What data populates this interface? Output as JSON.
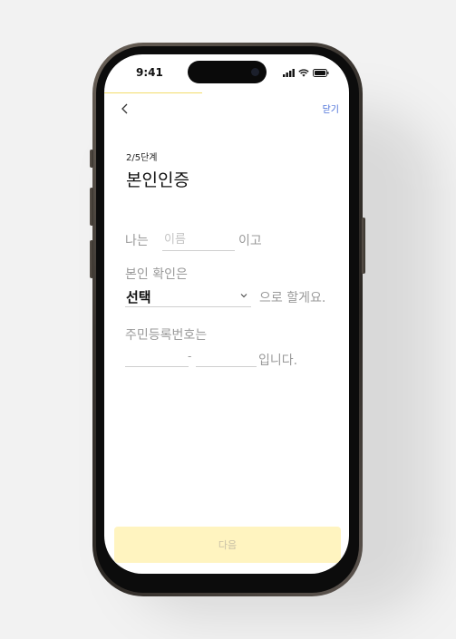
{
  "status_bar": {
    "time": "9:41",
    "icons": [
      "signal-bars-icon",
      "wifi-icon",
      "battery-icon"
    ]
  },
  "progress": {
    "step": 2,
    "total": 5,
    "fraction": 0.4,
    "color": "#f2dd6b"
  },
  "header": {
    "back_icon": "chevron-left-icon",
    "close_label": "닫기"
  },
  "step_label": "2/5단계",
  "page_title": "본인인증",
  "name_row": {
    "prefix": "나는",
    "input_placeholder": "이름",
    "input_value": "",
    "suffix": "이고"
  },
  "verify_row": {
    "label": "본인 확인은",
    "select_value": "선택",
    "select_icon": "chevron-down-icon",
    "suffix": "으로 할게요."
  },
  "rrn_row": {
    "label": "주민등록번호는",
    "front_value": "",
    "separator": "-",
    "back_value": "",
    "suffix": "입니다."
  },
  "footer": {
    "next_label": "다음",
    "next_bg": "#fff4c0"
  }
}
